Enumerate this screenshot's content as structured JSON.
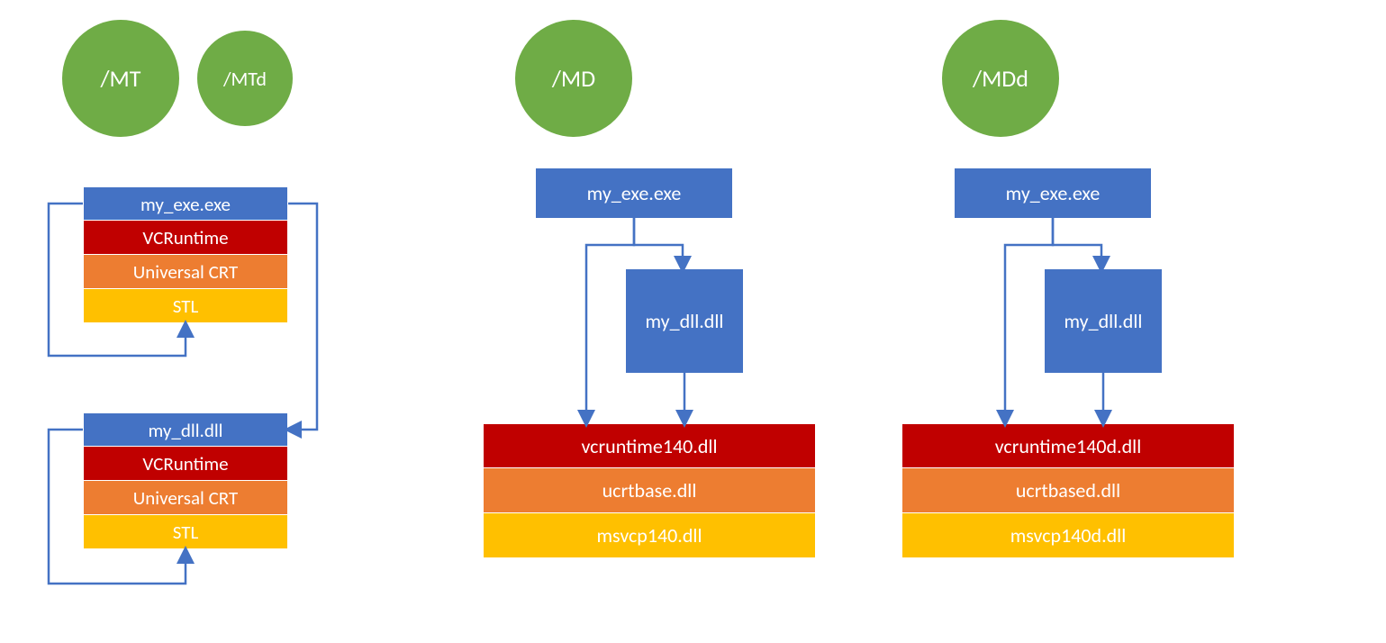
{
  "colors": {
    "green": "#6fac46",
    "blue": "#4472c4",
    "arrow": "#4472c4",
    "red": "#c00000",
    "orange": "#ed7d31",
    "amber": "#ffc000"
  },
  "labels": {
    "mt": "/MT",
    "mtd": "/MTd",
    "md": "/MD",
    "mdd": "/MDd"
  },
  "left": {
    "exe_stack": {
      "exe": "my_exe.exe",
      "vcruntime": "VCRuntime",
      "ucrt": "Universal CRT",
      "stl": "STL"
    },
    "dll_stack": {
      "dll": "my_dll.dll",
      "vcruntime": "VCRuntime",
      "ucrt": "Universal CRT",
      "stl": "STL"
    }
  },
  "center": {
    "exe": "my_exe.exe",
    "dll": "my_dll.dll",
    "stack": {
      "vcruntime": "vcruntime140.dll",
      "ucrtbase": "ucrtbase.dll",
      "msvcp": "msvcp140.dll"
    }
  },
  "right": {
    "exe": "my_exe.exe",
    "dll": "my_dll.dll",
    "stack": {
      "vcruntime": "vcruntime140d.dll",
      "ucrtbase": "ucrtbased.dll",
      "msvcp": "msvcp140d.dll"
    }
  }
}
